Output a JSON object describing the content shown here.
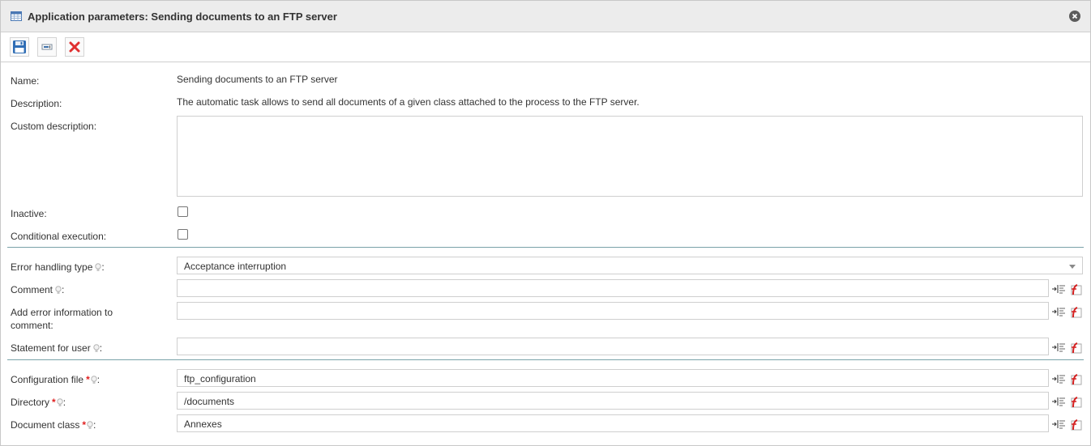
{
  "window": {
    "title": "Application parameters: Sending documents to an FTP server"
  },
  "toolbar": {
    "buttons": [
      {
        "name": "save-button",
        "icon": "floppy-disk-icon"
      },
      {
        "name": "properties-button",
        "icon": "form-icon"
      },
      {
        "name": "delete-button",
        "icon": "red-x-icon"
      }
    ]
  },
  "form": {
    "name_label": "Name:",
    "name_value": "Sending documents to an FTP server",
    "description_label": "Description:",
    "description_value": "The automatic task allows to send all documents of a given class attached to the process to the FTP server.",
    "custom_description_label": "Custom description:",
    "custom_description_value": "",
    "inactive_label": "Inactive:",
    "inactive_checked": false,
    "conditional_label": "Conditional execution:",
    "conditional_checked": false
  },
  "error_section": {
    "error_handling_label": "Error handling type",
    "error_handling_value": "Acceptance interruption",
    "comment_label": "Comment",
    "comment_value": "",
    "add_error_label_line1": "Add error information to",
    "add_error_label_line2": "comment:",
    "add_error_value": "",
    "statement_label": "Statement for user",
    "statement_value": ""
  },
  "config_section": {
    "config_file_label": "Configuration file",
    "config_file_value": "ftp_configuration",
    "directory_label": "Directory",
    "directory_value": "/documents",
    "document_class_label": "Document class",
    "document_class_value": "Annexes"
  },
  "colon": ":",
  "required_mark": "*",
  "colors": {
    "separator": "#7aa2a8",
    "required": "#e02020",
    "delete": "#e03030"
  }
}
